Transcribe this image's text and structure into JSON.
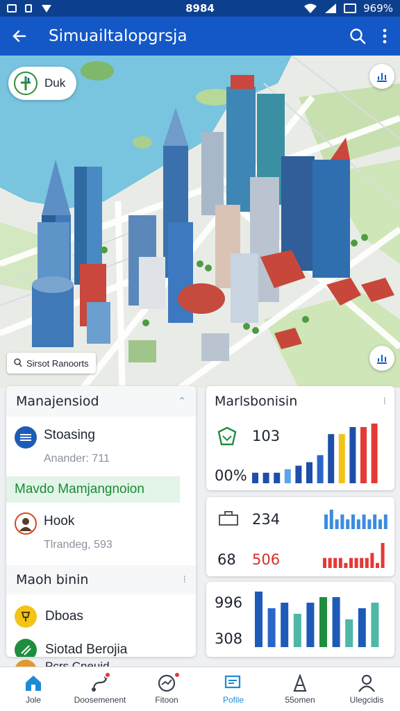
{
  "status_bar": {
    "time": "8984",
    "battery": "969%"
  },
  "app_bar": {
    "title": "Simuailtalopgrsja",
    "back_icon": "arrow-left-icon",
    "search_icon": "search-icon",
    "more_icon": "more-vertical-icon"
  },
  "map": {
    "chip_label": "Duk",
    "location_label": "Sirsot Ranoorts",
    "top_right_icon": "chart-icon",
    "bottom_right_icon": "chart-icon"
  },
  "left_panel": {
    "header": "Manajensiod",
    "items": [
      {
        "title": "Stoasing",
        "subtitle": "Anander: 711",
        "avatar_color": "#1e5bb8"
      },
      {
        "title": "Hook",
        "subtitle": "Tlrandeg, 593",
        "avatar_color": "#d14a1f"
      }
    ],
    "highlight": "Mavdo Mamjangnoion",
    "section2_header": "Maoh binin",
    "section2_items": [
      {
        "title": "Dboas",
        "avatar_color": "#f2c417"
      },
      {
        "title": "Siotad Berojia",
        "avatar_color": "#1e8e3e"
      }
    ],
    "cutoff_item": "Pcrs Cneuid"
  },
  "right_cards": {
    "card1": {
      "header": "Marlsbonisin",
      "metric_top": "103",
      "metric_bottom": "00%"
    },
    "card2": {
      "metric_top": "234",
      "metric_bottom_left": "68",
      "metric_bottom_right": "506"
    },
    "card3": {
      "metric_top": "996",
      "metric_bottom": "308"
    }
  },
  "chart_data": [
    {
      "type": "bar",
      "values": [
        3,
        3,
        3,
        4,
        5,
        6,
        8,
        14,
        14,
        16,
        16,
        17
      ],
      "colors": [
        "#1e4fa8",
        "#1e4fa8",
        "#1e4fa8",
        "#5aa7e6",
        "#1e4fa8",
        "#1e4fa8",
        "#2a66c9",
        "#1e4fa8",
        "#f2c417",
        "#1e4fa8",
        "#e53935",
        "#e53935"
      ]
    },
    {
      "type": "bar",
      "values": [
        3,
        4,
        2,
        3,
        2,
        3,
        2,
        3,
        2,
        3,
        2,
        3
      ],
      "color": "#3c8ce0"
    },
    {
      "type": "bar",
      "values": [
        2,
        2,
        2,
        2,
        1,
        2,
        2,
        2,
        2,
        3,
        1,
        5
      ],
      "color": "#e53935"
    },
    {
      "type": "bar",
      "values": [
        10,
        7,
        8,
        6,
        8,
        9,
        9,
        5,
        7,
        8
      ],
      "colors": [
        "#1e5bb8",
        "#2a66c9",
        "#1e5bb8",
        "#4fb7a5",
        "#1e5bb8",
        "#1e8e3e",
        "#1e5bb8",
        "#4fb7a5",
        "#1e5bb8",
        "#4fb7a5"
      ]
    }
  ],
  "bottom_nav": [
    {
      "label": "Jole",
      "icon": "home-icon",
      "active": false,
      "badge": false
    },
    {
      "label": "Doosemenent",
      "icon": "routes-icon",
      "active": false,
      "badge": true
    },
    {
      "label": "Fitoon",
      "icon": "stats-icon",
      "active": false,
      "badge": true
    },
    {
      "label": "Pofile",
      "icon": "chat-icon",
      "active": true,
      "badge": false
    },
    {
      "label": "55omen",
      "icon": "tower-icon",
      "active": false,
      "badge": false
    },
    {
      "label": "Ulegcidis",
      "icon": "user-icon",
      "active": false,
      "badge": false
    }
  ]
}
